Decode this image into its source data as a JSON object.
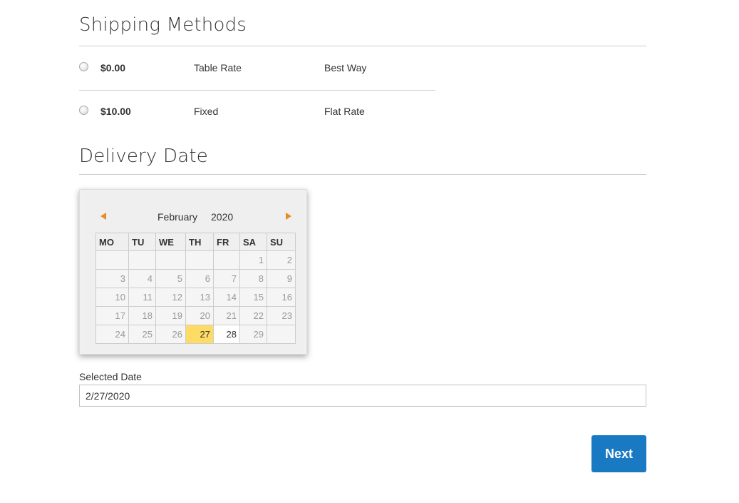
{
  "shipping": {
    "title": "Shipping Methods",
    "methods": [
      {
        "price": "$0.00",
        "method": "Table Rate",
        "carrier": "Best Way",
        "selected": false
      },
      {
        "price": "$10.00",
        "method": "Fixed",
        "carrier": "Flat Rate",
        "selected": false
      }
    ]
  },
  "delivery": {
    "title": "Delivery Date",
    "calendar": {
      "month": "February",
      "year": "2020",
      "weekdays": [
        "MO",
        "TU",
        "WE",
        "TH",
        "FR",
        "SA",
        "SU"
      ],
      "weeks": [
        [
          "",
          "",
          "",
          "",
          "",
          "1",
          "2"
        ],
        [
          "3",
          "4",
          "5",
          "6",
          "7",
          "8",
          "9"
        ],
        [
          "10",
          "11",
          "12",
          "13",
          "14",
          "15",
          "16"
        ],
        [
          "17",
          "18",
          "19",
          "20",
          "21",
          "22",
          "23"
        ],
        [
          "24",
          "25",
          "26",
          "27",
          "28",
          "29",
          ""
        ]
      ],
      "highlighted_day": "27",
      "enabled_days": [
        "27",
        "28"
      ],
      "highlight_color": "#fddb64",
      "nav_color": "#e98b24"
    },
    "selected_label": "Selected Date",
    "selected_value": "2/27/2020"
  },
  "actions": {
    "next_label": "Next",
    "next_color": "#1979c3"
  }
}
